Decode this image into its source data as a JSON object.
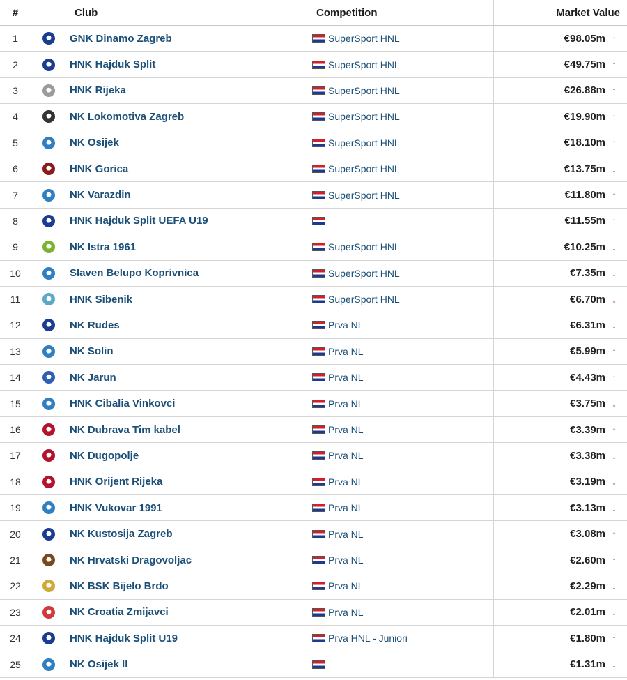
{
  "header": {
    "num": "#",
    "club": "Club",
    "competition": "Competition",
    "market_value": "Market Value"
  },
  "rows": [
    {
      "num": "1",
      "club": "GNK Dinamo Zagreb",
      "competition": "SuperSport HNL",
      "value": "€98.05m",
      "trend": "up",
      "logo_color": "#1b3d8f"
    },
    {
      "num": "2",
      "club": "HNK Hajduk Split",
      "competition": "SuperSport HNL",
      "value": "€49.75m",
      "trend": "up",
      "logo_color": "#1b3d8f"
    },
    {
      "num": "3",
      "club": "HNK Rijeka",
      "competition": "SuperSport HNL",
      "value": "€26.88m",
      "trend": "up",
      "logo_color": "#9b9b9b"
    },
    {
      "num": "4",
      "club": "NK Lokomotiva Zagreb",
      "competition": "SuperSport HNL",
      "value": "€19.90m",
      "trend": "up",
      "logo_color": "#333333"
    },
    {
      "num": "5",
      "club": "NK Osijek",
      "competition": "SuperSport HNL",
      "value": "€18.10m",
      "trend": "up",
      "logo_color": "#2f7fc1"
    },
    {
      "num": "6",
      "club": "HNK Gorica",
      "competition": "SuperSport HNL",
      "value": "€13.75m",
      "trend": "down",
      "logo_color": "#8b1a1a"
    },
    {
      "num": "7",
      "club": "NK Varazdin",
      "competition": "SuperSport HNL",
      "value": "€11.80m",
      "trend": "up",
      "logo_color": "#2f7fc1"
    },
    {
      "num": "8",
      "club": "HNK Hajduk Split UEFA U19",
      "competition": "",
      "value": "€11.55m",
      "trend": "up",
      "logo_color": "#1b3d8f"
    },
    {
      "num": "9",
      "club": "NK Istra 1961",
      "competition": "SuperSport HNL",
      "value": "€10.25m",
      "trend": "down",
      "logo_color": "#7ab32e"
    },
    {
      "num": "10",
      "club": "Slaven Belupo Koprivnica",
      "competition": "SuperSport HNL",
      "value": "€7.35m",
      "trend": "down",
      "logo_color": "#2f7fc1"
    },
    {
      "num": "11",
      "club": "HNK Sibenik",
      "competition": "SuperSport HNL",
      "value": "€6.70m",
      "trend": "down",
      "logo_color": "#5aa9c9"
    },
    {
      "num": "12",
      "club": "NK Rudes",
      "competition": "Prva NL",
      "value": "€6.31m",
      "trend": "down",
      "logo_color": "#1b3d8f"
    },
    {
      "num": "13",
      "club": "NK Solin",
      "competition": "Prva NL",
      "value": "€5.99m",
      "trend": "up",
      "logo_color": "#2f7fc1"
    },
    {
      "num": "14",
      "club": "NK Jarun",
      "competition": "Prva NL",
      "value": "€4.43m",
      "trend": "up",
      "logo_color": "#2f5fb3"
    },
    {
      "num": "15",
      "club": "HNK Cibalia Vinkovci",
      "competition": "Prva NL",
      "value": "€3.75m",
      "trend": "down",
      "logo_color": "#2f7fc1"
    },
    {
      "num": "16",
      "club": "NK Dubrava Tim kabel",
      "competition": "Prva NL",
      "value": "€3.39m",
      "trend": "up",
      "logo_color": "#b2142c"
    },
    {
      "num": "17",
      "club": "NK Dugopolje",
      "competition": "Prva NL",
      "value": "€3.38m",
      "trend": "down",
      "logo_color": "#b2142c"
    },
    {
      "num": "18",
      "club": "HNK Orijent Rijeka",
      "competition": "Prva NL",
      "value": "€3.19m",
      "trend": "down",
      "logo_color": "#b2142c"
    },
    {
      "num": "19",
      "club": "HNK Vukovar 1991",
      "competition": "Prva NL",
      "value": "€3.13m",
      "trend": "down",
      "logo_color": "#2f7fc1"
    },
    {
      "num": "20",
      "club": "NK Kustosija Zagreb",
      "competition": "Prva NL",
      "value": "€3.08m",
      "trend": "up",
      "logo_color": "#1b3d8f"
    },
    {
      "num": "21",
      "club": "NK Hrvatski Dragovoljac",
      "competition": "Prva NL",
      "value": "€2.60m",
      "trend": "up",
      "logo_color": "#7a4a1e"
    },
    {
      "num": "22",
      "club": "NK BSK Bijelo Brdo",
      "competition": "Prva NL",
      "value": "€2.29m",
      "trend": "down",
      "logo_color": "#d1a93a"
    },
    {
      "num": "23",
      "club": "NK Croatia Zmijavci",
      "competition": "Prva NL",
      "value": "€2.01m",
      "trend": "down",
      "logo_color": "#d13a3a"
    },
    {
      "num": "24",
      "club": "HNK Hajduk Split U19",
      "competition": "Prva HNL - Juniori",
      "value": "€1.80m",
      "trend": "up",
      "logo_color": "#1b3d8f"
    },
    {
      "num": "25",
      "club": "NK Osijek II",
      "competition": "",
      "value": "€1.31m",
      "trend": "down",
      "logo_color": "#2f7fc1"
    }
  ],
  "colors": {
    "link": "#1b4f77",
    "up": "#55a832",
    "down": "#b2142c",
    "border": "#d4d4d4"
  },
  "icons": {
    "up": "arrow-up-icon",
    "down": "arrow-down-icon",
    "flag": "croatia-flag-icon"
  }
}
